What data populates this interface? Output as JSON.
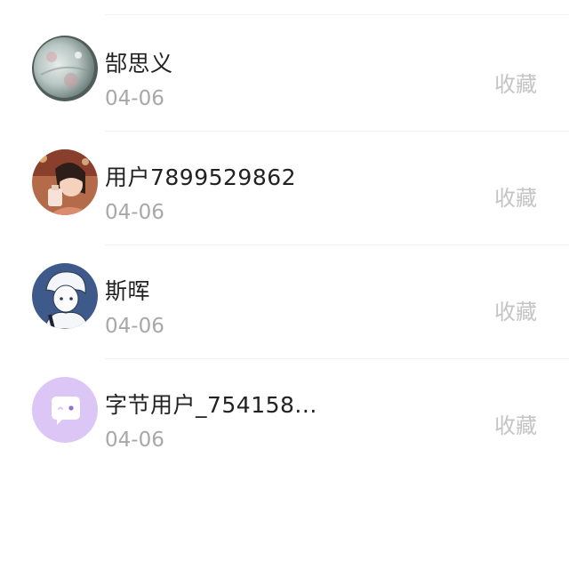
{
  "list": {
    "items": [
      {
        "name": "郜思义",
        "date": "04-06",
        "action": "收藏",
        "avatar": "planet-avatar"
      },
      {
        "name": "用户7899529862",
        "date": "04-06",
        "action": "收藏",
        "avatar": "girl-drinking-avatar"
      },
      {
        "name": "斯晖",
        "date": "04-06",
        "action": "收藏",
        "avatar": "anime-boy-avatar"
      },
      {
        "name": "字节用户_754158...",
        "date": "04-06",
        "action": "收藏",
        "avatar": "default-chat-bubble-avatar"
      }
    ]
  },
  "colors": {
    "name_text": "#222222",
    "date_text": "#a8a8a8",
    "action_text": "#c4c4c4",
    "default_avatar_bg": "#dcc6f5",
    "default_avatar_icon": "#ffffff",
    "divider": "#f2f2f2"
  }
}
